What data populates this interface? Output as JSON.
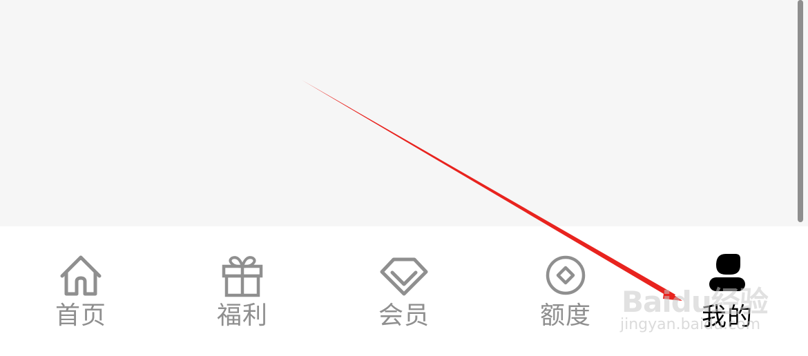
{
  "tab_bar": {
    "tabs": [
      {
        "label": "首页",
        "icon": "home-icon",
        "active": false
      },
      {
        "label": "福利",
        "icon": "gift-icon",
        "active": false
      },
      {
        "label": "会员",
        "icon": "diamond-icon",
        "active": false
      },
      {
        "label": "额度",
        "icon": "coin-icon",
        "active": false
      },
      {
        "label": "我的",
        "icon": "user-icon",
        "active": true
      }
    ]
  },
  "watermark": {
    "logo": "Baidu经验",
    "url": "jingyan.baidu.com"
  },
  "colors": {
    "inactive": "#8f8f8f",
    "active": "#000000",
    "content_bg": "#f6f6f6",
    "arrow": "#e8231e"
  }
}
